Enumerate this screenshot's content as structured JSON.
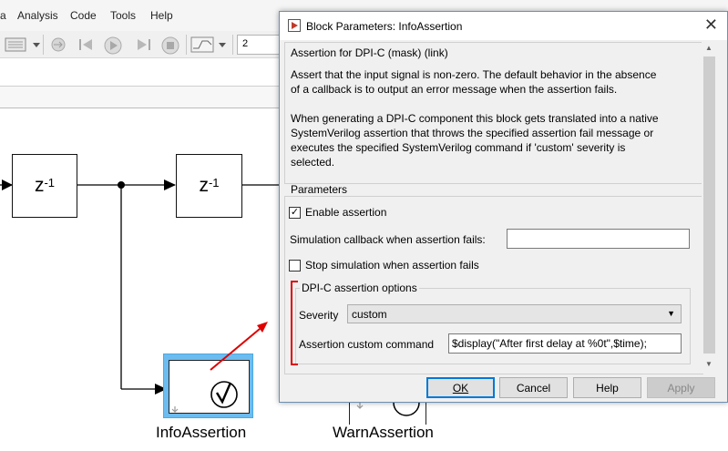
{
  "menu": {
    "items": [
      "Analysis",
      "Code",
      "Tools",
      "Help"
    ]
  },
  "toolbar": {
    "stop_time": "2"
  },
  "diagram": {
    "delay_block_1": {
      "base": "z",
      "exponent": "-1"
    },
    "delay_block_2": {
      "base": "z",
      "exponent": "-1"
    },
    "info_assertion_label": "InfoAssertion",
    "warn_assertion_label": "WarnAssertion",
    "selection_color": "#6cbcf0",
    "annotation_color": "#e00000"
  },
  "dialog": {
    "title": "Block Parameters: InfoAssertion",
    "mask_header": "Assertion for DPI-C (mask) (link)",
    "description_lines_1": [
      "Assert that the input signal is non-zero. The default behavior in the absence",
      "of a callback is to output an error message when the assertion fails."
    ],
    "description_lines_2": [
      "When generating a DPI-C component this block gets translated into a native",
      "SystemVerilog assertion that throws the specified assertion fail message or",
      "executes the specified SystemVerilog command if 'custom' severity is",
      "selected."
    ],
    "parameters_label": "Parameters",
    "enable_assertion": {
      "label": "Enable assertion",
      "checked": true
    },
    "sim_callback": {
      "label": "Simulation callback when assertion fails:",
      "value": ""
    },
    "stop_simulation": {
      "label": "Stop simulation when assertion fails",
      "checked": false
    },
    "dpi_group_label": "DPI-C assertion options",
    "severity": {
      "label": "Severity",
      "value": "custom"
    },
    "custom_command": {
      "label": "Assertion custom command",
      "value": "$display(\"After first delay at %0t\",$time);"
    },
    "buttons": {
      "ok": "OK",
      "cancel": "Cancel",
      "help": "Help",
      "apply": "Apply"
    }
  }
}
